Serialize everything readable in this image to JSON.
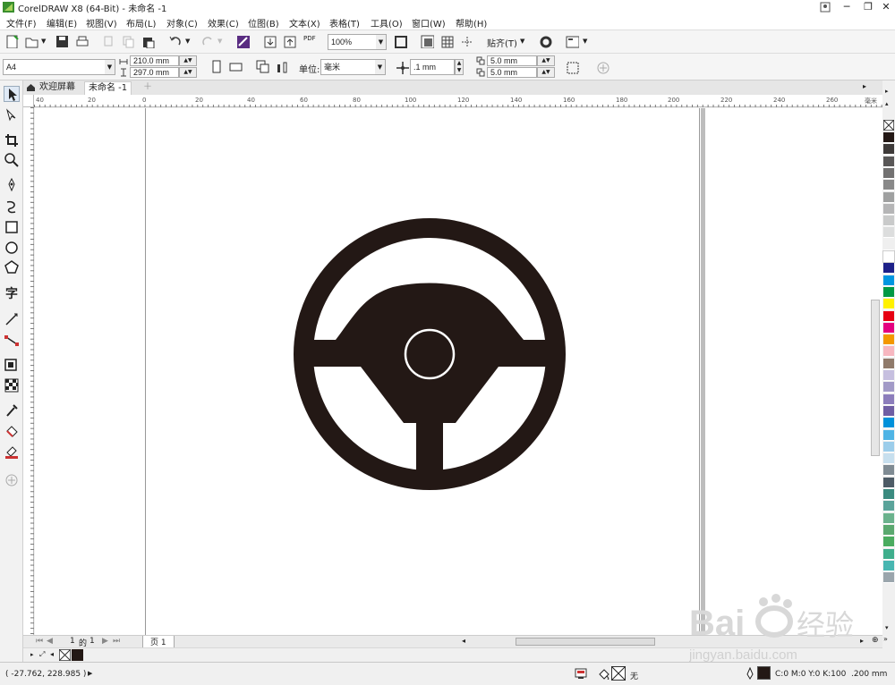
{
  "app": {
    "title": "CorelDRAW X8 (64-Bit) - 未命名 -1"
  },
  "menu": [
    "文件(F)",
    "编辑(E)",
    "视图(V)",
    "布局(L)",
    "对象(C)",
    "效果(C)",
    "位图(B)",
    "文本(X)",
    "表格(T)",
    "工具(O)",
    "窗口(W)",
    "帮助(H)"
  ],
  "toolbar": {
    "zoom_value": "100%",
    "snap_label": "贴齐(T)",
    "pdf_label": "PDF"
  },
  "property_bar": {
    "page_size": "A4",
    "width": "210.0 mm",
    "height": "297.0 mm",
    "unit_label": "单位:",
    "unit_value": "毫米",
    "nudge": ".1 mm",
    "dup_x": "5.0 mm",
    "dup_y": "5.0 mm"
  },
  "tabs": {
    "welcome": "欢迎屏幕",
    "document": "未命名 -1"
  },
  "ruler": {
    "unit": "毫米",
    "h_ticks": [
      "40",
      "20",
      "0",
      "20",
      "40",
      "60",
      "80",
      "100",
      "120",
      "140",
      "160",
      "180",
      "200",
      "220",
      "240",
      "260"
    ],
    "v_ticks": [
      "280",
      "260",
      "240",
      "220",
      "200",
      "180",
      "160",
      "140",
      "120",
      "100",
      "80",
      "60"
    ]
  },
  "page_nav": {
    "current": "1",
    "of_label": "的",
    "total": "1",
    "page_tab": "页 1"
  },
  "status": {
    "cursor_coords": "( -27.762, 228.985 )",
    "fill_label": "无",
    "color_info": "C:0 M:0 Y:0 K:100",
    "outline_width": ".200 mm"
  },
  "drawing": {
    "fill_color": "#231815"
  },
  "palette_colors": [
    "#231815",
    "#3e3a39",
    "#595757",
    "#727171",
    "#898989",
    "#9fa0a0",
    "#b5b5b6",
    "#c9caca",
    "#dcdddd",
    "#efefef",
    "#ffffff",
    "#1d2088",
    "#0096e0",
    "#009944",
    "#fff100",
    "#e60012",
    "#e4007f",
    "#f39800",
    "#f7b7c0",
    "#8f7a6a",
    "#c6bfdf",
    "#a29ac7",
    "#8c7dbb",
    "#6f5ea3",
    "#0091da",
    "#4fb4e5",
    "#9ccdea",
    "#c7dfee",
    "#7f8b93",
    "#4d5b66",
    "#3a8a7f",
    "#5aa39a",
    "#6bb28d",
    "#5aa86f",
    "#4aab5f",
    "#3fae8c",
    "#48b6b1",
    "#9aa5ac"
  ],
  "watermark": {
    "brand": "Bai",
    "brand2": "经验",
    "url": "jingyan.baidu.com"
  }
}
